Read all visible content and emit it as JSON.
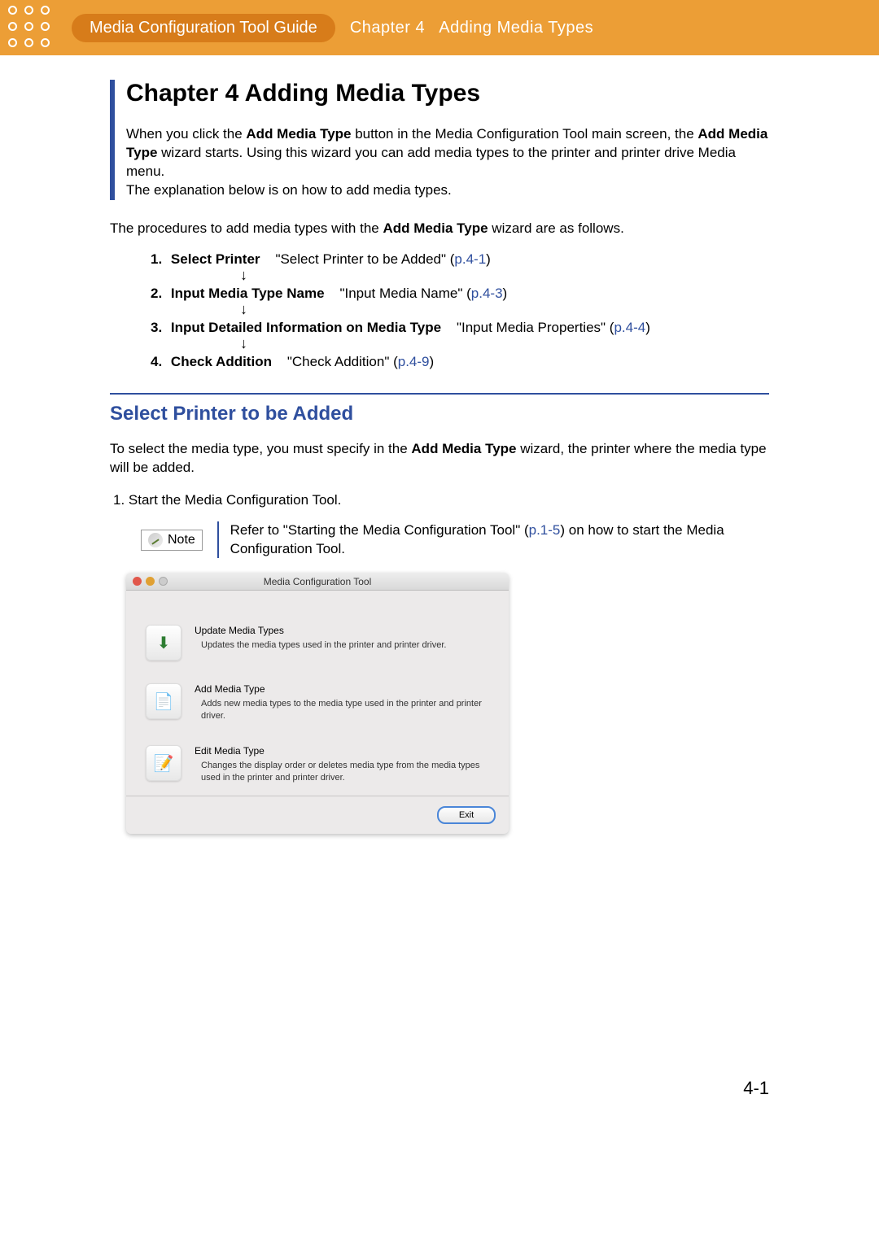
{
  "banner": {
    "guide_title": "Media Configuration Tool Guide",
    "chapter_label": "Chapter 4",
    "chapter_name": "Adding Media Types"
  },
  "chapter": {
    "heading": "Chapter 4  Adding Media Types",
    "intro_pre": "When you click the ",
    "intro_bold1": "Add Media Type",
    "intro_mid1": " button in the Media Configuration Tool main screen, the ",
    "intro_bold2": "Add Media Type",
    "intro_mid2": " wizard starts. Using this wizard you can add media types to the printer and printer drive Media menu.",
    "intro_line2": "The explanation below is on how to add media types."
  },
  "procedures_intro_pre": "The procedures to add media types with the ",
  "procedures_intro_bold": "Add Media Type",
  "procedures_intro_post": " wizard are as follows.",
  "steps": [
    {
      "num": "1.",
      "name": "Select Printer",
      "quote": "\"Select Printer to be Added\" (",
      "page": "p.4-1",
      "close": ")",
      "arrow": true
    },
    {
      "num": "2.",
      "name": "Input Media Type Name",
      "quote": "\"Input Media Name\" (",
      "page": "p.4-3",
      "close": ")",
      "arrow": true
    },
    {
      "num": "3.",
      "name": "Input Detailed Information on Media Type",
      "quote": "\"Input Media Properties\" (",
      "page": "p.4-4",
      "close": ")",
      "arrow": true
    },
    {
      "num": "4.",
      "name": "Check Addition",
      "quote": "\"Check Addition\" (",
      "page": "p.4-9",
      "close": ")",
      "arrow": false
    }
  ],
  "section": {
    "heading": "Select Printer to be Added",
    "text_pre": "To select the media type, you must specify in the ",
    "text_bold": "Add Media Type",
    "text_post": " wizard, the printer where the media type will be added.",
    "step1": "1.  Start the Media Configuration Tool."
  },
  "note": {
    "label": "Note",
    "text_pre": "Refer to \"Starting the Media Configuration Tool\" (",
    "page": "p.1-5",
    "text_post": ") on how to start the Media Configuration Tool."
  },
  "app_window": {
    "title": "Media Configuration Tool",
    "items": [
      {
        "title": "Update Media Types",
        "desc": "Updates the media types used in the printer and printer driver."
      },
      {
        "title": "Add Media Type",
        "desc": "Adds new media types to the media type used in the printer and printer driver."
      },
      {
        "title": "Edit Media Type",
        "desc": "Changes the display order or deletes media type from the media types used in the printer and printer driver."
      }
    ],
    "exit_label": "Exit"
  },
  "page_number": "4-1"
}
